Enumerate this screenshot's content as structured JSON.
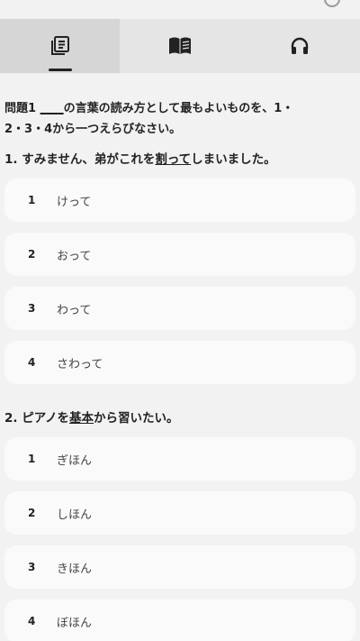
{
  "tabs": [
    {
      "icon": "document-icon",
      "active": true
    },
    {
      "icon": "book-icon",
      "active": false
    },
    {
      "icon": "headphones-icon",
      "active": false
    }
  ],
  "intro": {
    "prefix": "問題1 ",
    "blank": "____",
    "suffix_line1": "の言葉の読み方として最もよいものを、1・",
    "line2": "2・3・4から一つえらびなさい。"
  },
  "questions": [
    {
      "num": "1.",
      "before": "すみません、弟がこれを",
      "underlined": "割って",
      "after": "しまいました。",
      "options": [
        {
          "num": "1",
          "text": "けって"
        },
        {
          "num": "2",
          "text": "おって"
        },
        {
          "num": "3",
          "text": "わって"
        },
        {
          "num": "4",
          "text": "さわって"
        }
      ]
    },
    {
      "num": "2.",
      "before": "ピアノを",
      "underlined": "基本",
      "after": "から習いたい。",
      "options": [
        {
          "num": "1",
          "text": "ぎほん"
        },
        {
          "num": "2",
          "text": "しほん"
        },
        {
          "num": "3",
          "text": "きほん"
        },
        {
          "num": "4",
          "text": "ぼほん"
        }
      ]
    }
  ]
}
